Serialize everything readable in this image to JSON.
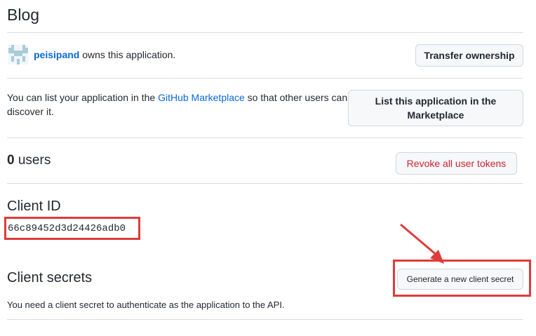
{
  "app": {
    "title": "Blog"
  },
  "owner": {
    "username": "peisipand",
    "suffix_text": " owns this application.",
    "transfer_button": "Transfer ownership"
  },
  "marketplace": {
    "text_before": "You can list your application in the ",
    "link_text": "GitHub Marketplace",
    "text_after_line1": " so that other users can",
    "text_line2": "discover it.",
    "button_line1": "List this application in the",
    "button_line2": "Marketplace"
  },
  "users": {
    "count": "0",
    "label": " users",
    "revoke_button": "Revoke all user tokens"
  },
  "client_id": {
    "heading": "Client ID",
    "value": "66c89452d3d24426adb0"
  },
  "client_secrets": {
    "heading": "Client secrets",
    "generate_button": "Generate a new client secret",
    "description": "You need a client secret to authenticate as the application to the API."
  },
  "colors": {
    "annotation": "#e03b3b",
    "link": "#0969da",
    "danger": "#cf222e"
  },
  "icons": {
    "avatar": "identicon-avatar",
    "annotation_arrow": "red-arrow-icon"
  }
}
